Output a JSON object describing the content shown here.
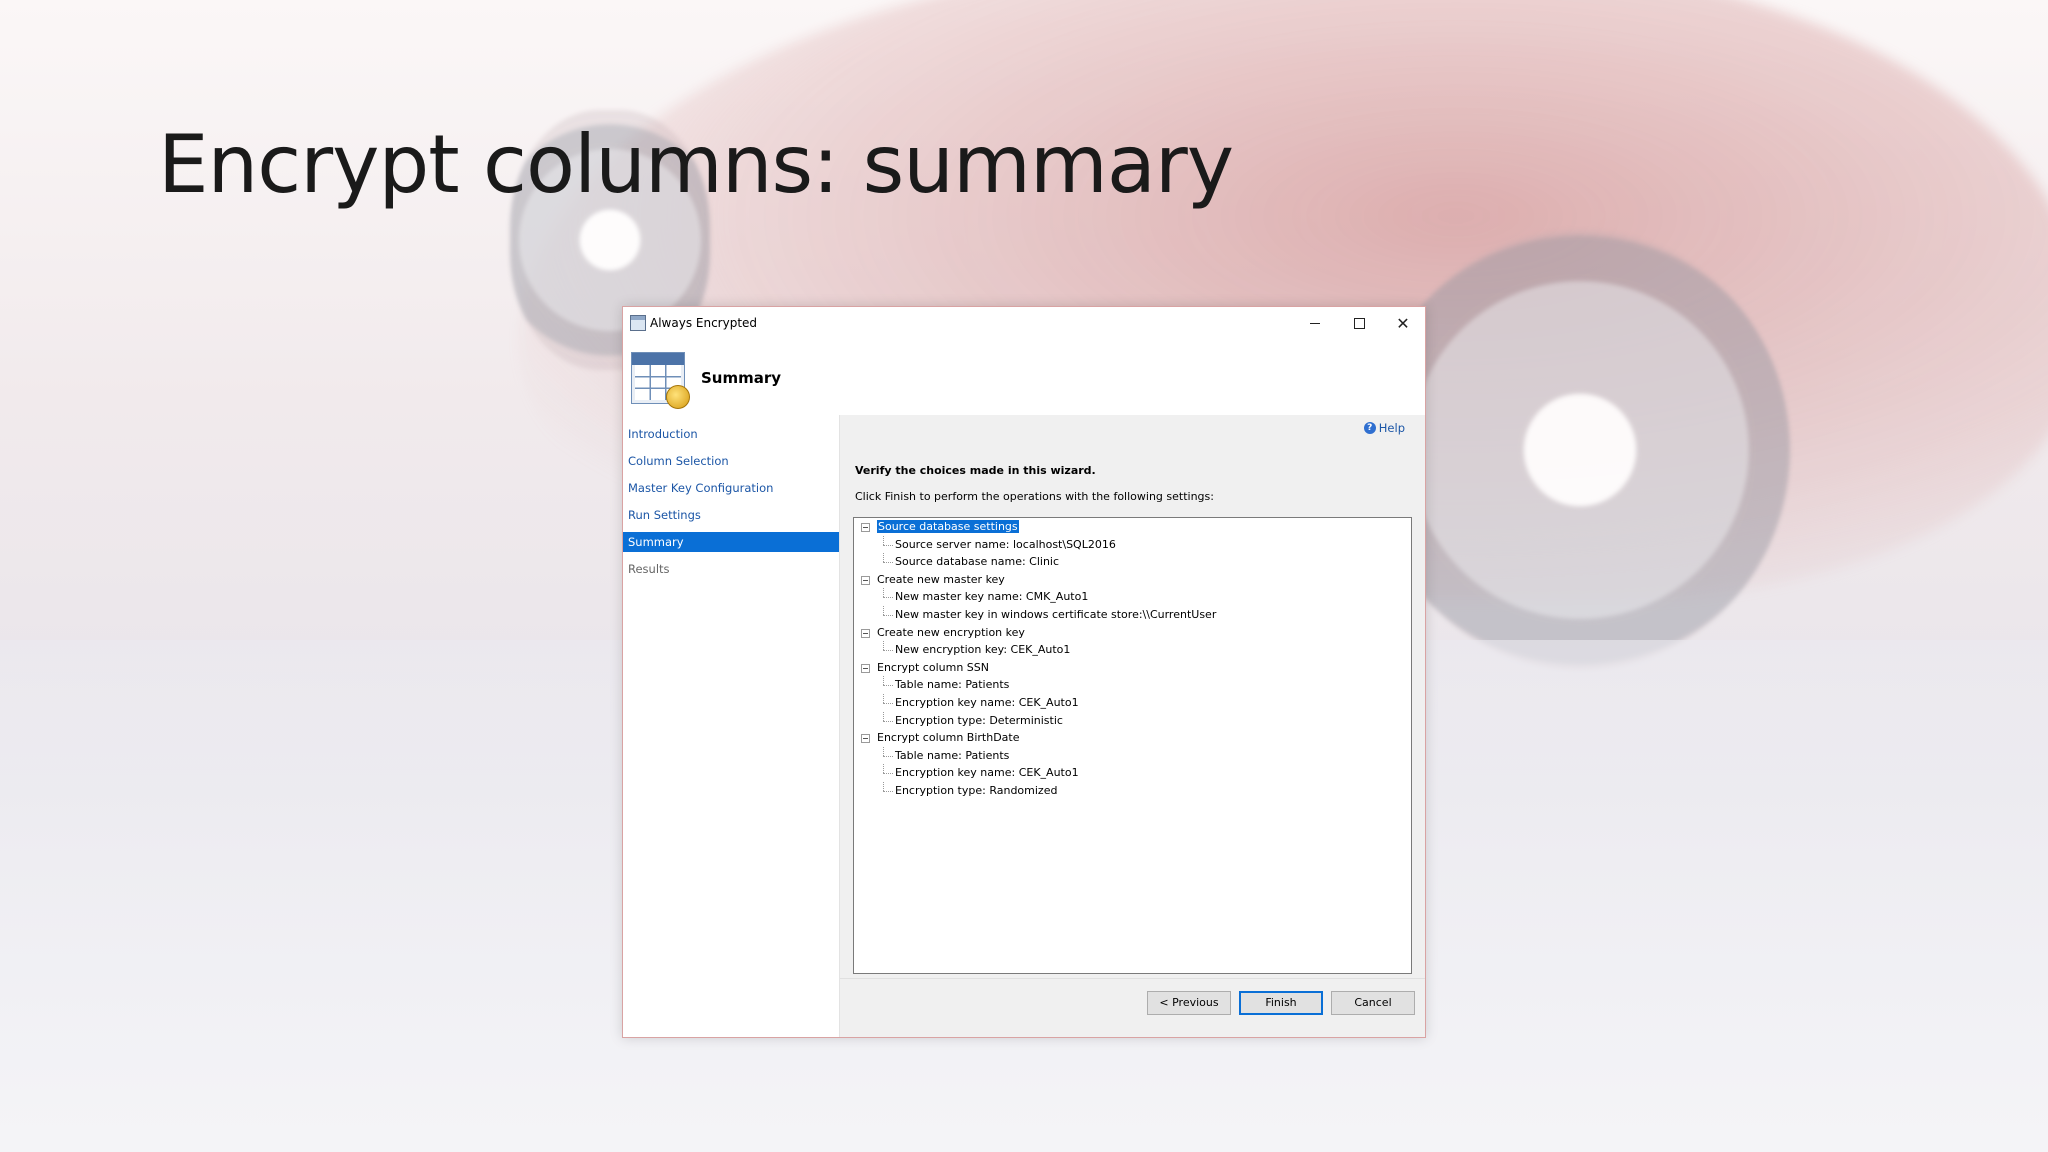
{
  "slide": {
    "title": "Encrypt columns: summary"
  },
  "dialog": {
    "window_title": "Always Encrypted",
    "window_controls": {
      "minimize": "–",
      "maximize": "",
      "close": "✕"
    },
    "header": {
      "heading": "Summary",
      "icon": "table-key-icon"
    },
    "sidebar": {
      "items": [
        {
          "label": "Introduction",
          "state": "link"
        },
        {
          "label": "Column Selection",
          "state": "link"
        },
        {
          "label": "Master Key Configuration",
          "state": "link"
        },
        {
          "label": "Run Settings",
          "state": "link"
        },
        {
          "label": "Summary",
          "state": "active"
        },
        {
          "label": "Results",
          "state": "disabled"
        }
      ]
    },
    "help": {
      "label": "Help",
      "icon": "help-icon"
    },
    "verify_text": "Verify the choices made in this wizard.",
    "instruction_text": "Click Finish to perform the operations with the following settings:",
    "tree": [
      {
        "label": "Source database settings",
        "selected": true,
        "children": [
          "Source server name: localhost\\SQL2016",
          "Source database name: Clinic"
        ]
      },
      {
        "label": "Create new master key",
        "selected": false,
        "children": [
          "New master key name: CMK_Auto1",
          "New master key in windows certificate store:\\\\CurrentUser"
        ]
      },
      {
        "label": "Create new encryption key",
        "selected": false,
        "children": [
          "New encryption key: CEK_Auto1"
        ]
      },
      {
        "label": "Encrypt column SSN",
        "selected": false,
        "children": [
          "Table name: Patients",
          "Encryption key name: CEK_Auto1",
          "Encryption type: Deterministic"
        ]
      },
      {
        "label": "Encrypt column BirthDate",
        "selected": false,
        "children": [
          "Table name: Patients",
          "Encryption key name: CEK_Auto1",
          "Encryption type: Randomized"
        ]
      }
    ],
    "buttons": {
      "previous": "< Previous",
      "finish": "Finish",
      "cancel": "Cancel"
    }
  },
  "colors": {
    "accent": "#0a6fd6",
    "link": "#1c56a6"
  }
}
